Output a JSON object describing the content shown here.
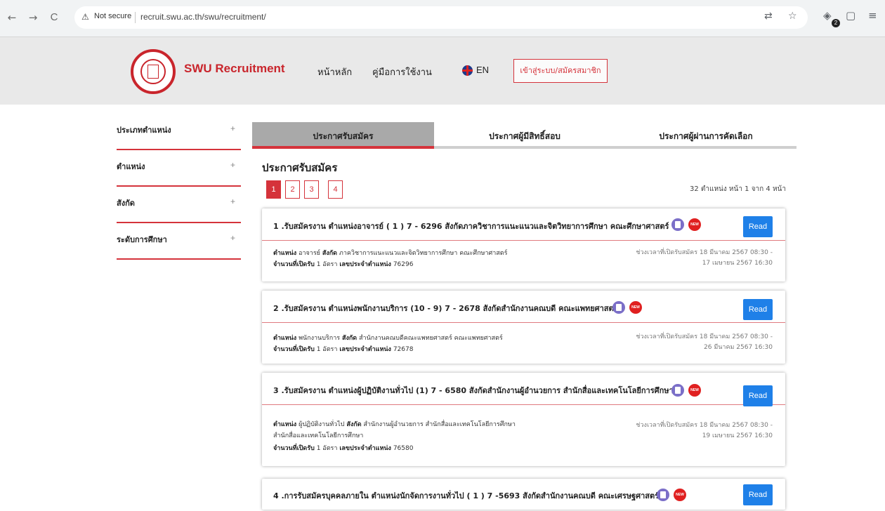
{
  "browser": {
    "back": "←",
    "forward": "→",
    "reload": "C",
    "security_label": "Not secure",
    "url": "recruit.swu.ac.th/swu/recruitment/",
    "extension_badge": "2"
  },
  "header": {
    "brand": "SWU Recruitment",
    "menu": [
      "หน้าหลัก",
      "คู่มือการใช้งาน"
    ],
    "language": "EN",
    "login": "เข้าสู่ระบบ/สมัครสมาชิก"
  },
  "sidebar": {
    "items": [
      {
        "label": "ประเภทตำแหน่ง",
        "toggle": "+"
      },
      {
        "label": "ตำแหน่ง",
        "toggle": "+"
      },
      {
        "label": "สังกัด",
        "toggle": "+"
      },
      {
        "label": "ระดับการศึกษา",
        "toggle": "+"
      }
    ]
  },
  "tabs": [
    {
      "label": "ประกาศรับสมัคร",
      "active": true
    },
    {
      "label": "ประกาศผู้มีสิทธิ์สอบ",
      "active": false
    },
    {
      "label": "ประกาศผู้ผ่านการคัดเลือก",
      "active": false
    }
  ],
  "main": {
    "section_title": "ประกาศรับสมัคร",
    "pages": [
      "1",
      "2",
      "3",
      "4"
    ],
    "current_page": "1",
    "page_info": "32 ตำแหน่ง หน้า 1 จาก 4 หน้า"
  },
  "labels": {
    "position": "ตำแหน่ง",
    "affiliation": "สังกัด",
    "count": "จำนวนที่เปิดรับ",
    "position_no": "เลขประจำตำแหน่ง",
    "rate": "อัตรา",
    "period": "ช่วงเวลาที่เปิดรับสมัคร",
    "read": "Read",
    "new": "NEW"
  },
  "jobs": [
    {
      "title": "1 .รับสมัครงาน ตำแหน่งอาจารย์ ( 1 ) 7 - 6296 สังกัดภาควิชาการแนะแนวและจิตวิทยาการศึกษา คณะศึกษาศาสตร์",
      "position": "อาจารย์",
      "affiliation": "ภาควิชาการแนะแนวและจิตวิทยาการศึกษา คณะศึกษาศาสตร์",
      "affiliation2": "",
      "count": "1",
      "position_no": "76296",
      "period_start": "18 มีนาคม 2567 08:30 -",
      "period_end": "17 เมษายน 2567 16:30"
    },
    {
      "title": "2 .รับสมัครงาน ตำแหน่งพนักงานบริการ (10 - 9) 7 - 2678 สังกัดสำนักงานคณบดี คณะแพทยศาสตร์",
      "position": "พนักงานบริการ",
      "affiliation": "สำนักงานคณบดีคณะแพทยศาสตร์ คณะแพทยศาสตร์",
      "affiliation2": "",
      "count": "1",
      "position_no": "72678",
      "period_start": "18 มีนาคม 2567 08:30 -",
      "period_end": "26 มีนาคม 2567 16:30"
    },
    {
      "title": "3 .รับสมัครงาน ตำแหน่งผู้ปฏิบัติงานทั่วไป (1) 7 - 6580 สังกัดสำนักงานผู้อำนวยการ สำนักสื่อและเทคโนโลยีการศึกษา",
      "position": "ผู้ปฏิบัติงานทั่วไป",
      "affiliation": "สำนักงานผู้อำนวยการ สำนักสื่อและเทคโนโลยีการศึกษา",
      "affiliation2": "สำนักสื่อและเทคโนโลยีการศึกษา",
      "count": "1",
      "position_no": "76580",
      "period_start": "18 มีนาคม 2567 08:30 -",
      "period_end": "19 เมษายน 2567 16:30"
    },
    {
      "title": "4 .การรับสมัครบุคคลภายใน ตำแหน่งนักจัดการงานทั่วไป ( 1 ) 7 -5693 สังกัดสำนักงานคณบดี คณะเศรษฐศาสตร์"
    }
  ]
}
